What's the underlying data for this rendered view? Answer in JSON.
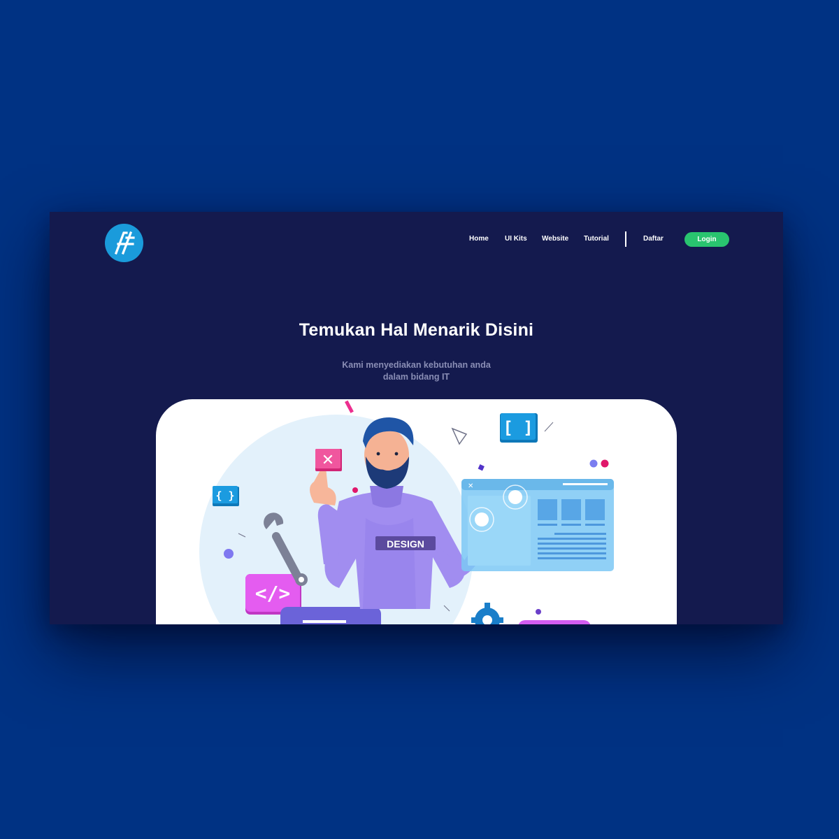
{
  "brand": {
    "logo_text": "AF",
    "accent_color": "#1a9bdb"
  },
  "nav": {
    "items": [
      {
        "label": "Home"
      },
      {
        "label": "UI Kits"
      },
      {
        "label": "Website"
      },
      {
        "label": "Tutorial"
      }
    ],
    "register_label": "Daftar",
    "login_label": "Login"
  },
  "hero": {
    "title": "Temukan Hal Menarik Disini",
    "subtitle_line1": "Kami menyediakan kebutuhan anda",
    "subtitle_line2": "dalam bidang IT"
  },
  "illustration": {
    "shirt_text": "DESIGN"
  },
  "colors": {
    "page_background": "#003283",
    "mockup_background": "#141a4e",
    "login_button": "#29c46f",
    "subtitle": "#8a8eb5"
  }
}
